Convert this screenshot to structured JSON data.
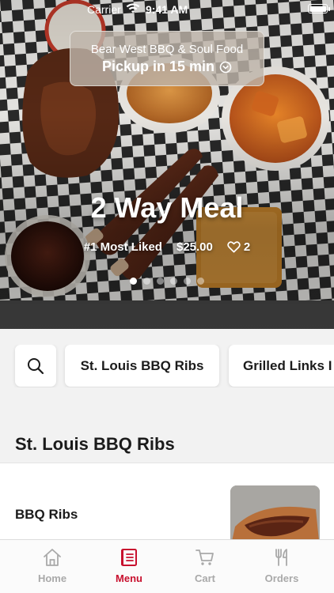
{
  "status_bar": {
    "carrier": "Carrier",
    "time": "9:41 AM"
  },
  "pickup": {
    "restaurant": "Bear West BBQ & Soul Food",
    "label": "Pickup in 15 min"
  },
  "featured": {
    "title": "2 Way Meal",
    "badge": "#1 Most Liked",
    "price": "$25.00",
    "likes": "2",
    "slides": 6,
    "active_slide": 1
  },
  "categories": [
    {
      "label": "St. Louis BBQ Ribs"
    },
    {
      "label": "Grilled Links I"
    }
  ],
  "section": {
    "title": "St. Louis BBQ Ribs"
  },
  "menu_item": {
    "name": "BBQ Ribs"
  },
  "tabs": [
    {
      "label": "Home",
      "icon": "home-icon"
    },
    {
      "label": "Menu",
      "icon": "menu-icon"
    },
    {
      "label": "Cart",
      "icon": "cart-icon"
    },
    {
      "label": "Orders",
      "icon": "orders-icon"
    }
  ],
  "active_tab": "Menu",
  "colors": {
    "accent": "#c8102e",
    "inactive": "#a9a9a9",
    "text": "#1b1b1b"
  }
}
